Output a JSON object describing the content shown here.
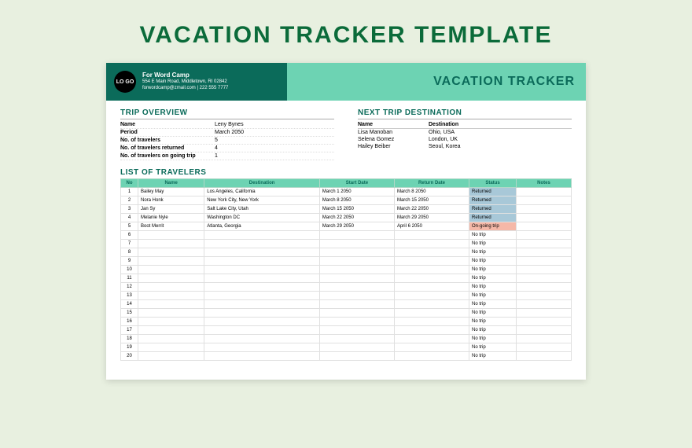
{
  "page_title": "VACATION TRACKER TEMPLATE",
  "header": {
    "logo_text": "LO GO",
    "company_name": "For Word Camp",
    "address": "554 E Main Road, Middletown, RI 02842",
    "contact": "forwordcamp@zmail.com | 222 555 7777",
    "tracker_title": "VACATION TRACKER"
  },
  "trip_overview": {
    "title": "TRIP OVERVIEW",
    "rows": [
      {
        "k": "Name",
        "v": "Leny Bynes"
      },
      {
        "k": "Period",
        "v": "March 2050"
      },
      {
        "k": "No. of travelers",
        "v": "5"
      },
      {
        "k": "No. of travelers returned",
        "v": "4"
      },
      {
        "k": "No. of travelers on going trip",
        "v": "1"
      }
    ]
  },
  "next_trip": {
    "title": "NEXT TRIP DESTINATION",
    "headers": {
      "name": "Name",
      "dest": "Destination"
    },
    "rows": [
      {
        "name": "Lisa Manoban",
        "dest": "Ohio, USA"
      },
      {
        "name": "Selena Gomez",
        "dest": "London, UK"
      },
      {
        "name": "Hailey Beiber",
        "dest": "Seoul, Korea"
      }
    ]
  },
  "travelers": {
    "title": "LIST OF TRAVELERS",
    "columns": [
      "No",
      "Name",
      "Destination",
      "Start Date",
      "Return Date",
      "Status",
      "Notes"
    ],
    "rows": [
      {
        "no": "1",
        "name": "Bailey May",
        "dest": "Los Angeles, California",
        "start": "March 1 2050",
        "return": "March 8 2050",
        "status": "Returned",
        "status_class": "status-returned",
        "notes": ""
      },
      {
        "no": "2",
        "name": "Nora Honk",
        "dest": "New York City, New York",
        "start": "March 8 2050",
        "return": "March 15 2050",
        "status": "Returned",
        "status_class": "status-returned",
        "notes": ""
      },
      {
        "no": "3",
        "name": "Jan Sy",
        "dest": "Salt Lake City, Utah",
        "start": "March 15 2050",
        "return": "March 22 2050",
        "status": "Returned",
        "status_class": "status-returned",
        "notes": ""
      },
      {
        "no": "4",
        "name": "Melanie Nyle",
        "dest": "Washington DC",
        "start": "March 22 2050",
        "return": "March 29 2050",
        "status": "Returned",
        "status_class": "status-returned",
        "notes": ""
      },
      {
        "no": "5",
        "name": "Boot Merrit",
        "dest": "Atlanta, Georgia",
        "start": "March 29 2050",
        "return": "April 6 2050",
        "status": "On-going trip",
        "status_class": "status-ongoing",
        "notes": ""
      },
      {
        "no": "6",
        "name": "",
        "dest": "",
        "start": "",
        "return": "",
        "status": "No trip",
        "status_class": "",
        "notes": ""
      },
      {
        "no": "7",
        "name": "",
        "dest": "",
        "start": "",
        "return": "",
        "status": "No trip",
        "status_class": "",
        "notes": ""
      },
      {
        "no": "8",
        "name": "",
        "dest": "",
        "start": "",
        "return": "",
        "status": "No trip",
        "status_class": "",
        "notes": ""
      },
      {
        "no": "9",
        "name": "",
        "dest": "",
        "start": "",
        "return": "",
        "status": "No trip",
        "status_class": "",
        "notes": ""
      },
      {
        "no": "10",
        "name": "",
        "dest": "",
        "start": "",
        "return": "",
        "status": "No trip",
        "status_class": "",
        "notes": ""
      },
      {
        "no": "11",
        "name": "",
        "dest": "",
        "start": "",
        "return": "",
        "status": "No trip",
        "status_class": "",
        "notes": ""
      },
      {
        "no": "12",
        "name": "",
        "dest": "",
        "start": "",
        "return": "",
        "status": "No trip",
        "status_class": "",
        "notes": ""
      },
      {
        "no": "13",
        "name": "",
        "dest": "",
        "start": "",
        "return": "",
        "status": "No trip",
        "status_class": "",
        "notes": ""
      },
      {
        "no": "14",
        "name": "",
        "dest": "",
        "start": "",
        "return": "",
        "status": "No trip",
        "status_class": "",
        "notes": ""
      },
      {
        "no": "15",
        "name": "",
        "dest": "",
        "start": "",
        "return": "",
        "status": "No trip",
        "status_class": "",
        "notes": ""
      },
      {
        "no": "16",
        "name": "",
        "dest": "",
        "start": "",
        "return": "",
        "status": "No trip",
        "status_class": "",
        "notes": ""
      },
      {
        "no": "17",
        "name": "",
        "dest": "",
        "start": "",
        "return": "",
        "status": "No trip",
        "status_class": "",
        "notes": ""
      },
      {
        "no": "18",
        "name": "",
        "dest": "",
        "start": "",
        "return": "",
        "status": "No trip",
        "status_class": "",
        "notes": ""
      },
      {
        "no": "19",
        "name": "",
        "dest": "",
        "start": "",
        "return": "",
        "status": "No trip",
        "status_class": "",
        "notes": ""
      },
      {
        "no": "20",
        "name": "",
        "dest": "",
        "start": "",
        "return": "",
        "status": "No trip",
        "status_class": "",
        "notes": ""
      }
    ]
  }
}
